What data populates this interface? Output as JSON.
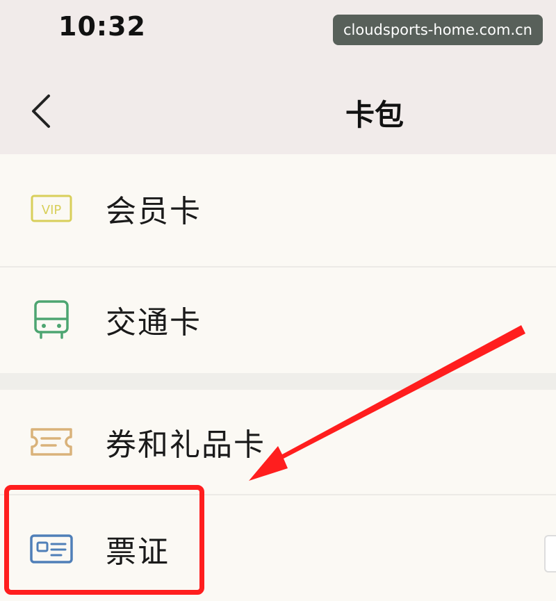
{
  "status": {
    "time": "10:32"
  },
  "watermark": {
    "text": "cloudsports-home.com.cn"
  },
  "header": {
    "title": "卡包"
  },
  "items": [
    {
      "label": "会员卡",
      "icon": "vip-icon",
      "badge": "VIP"
    },
    {
      "label": "交通卡",
      "icon": "bus-icon"
    },
    {
      "label": "券和礼品卡",
      "icon": "ticket-icon"
    },
    {
      "label": "票证",
      "icon": "id-card-icon"
    }
  ],
  "colors": {
    "highlight": "#ff1e1e",
    "vip": "#d8cf5a",
    "bus": "#4da571",
    "ticket": "#d9b27a",
    "idcard": "#4f7fb8"
  }
}
